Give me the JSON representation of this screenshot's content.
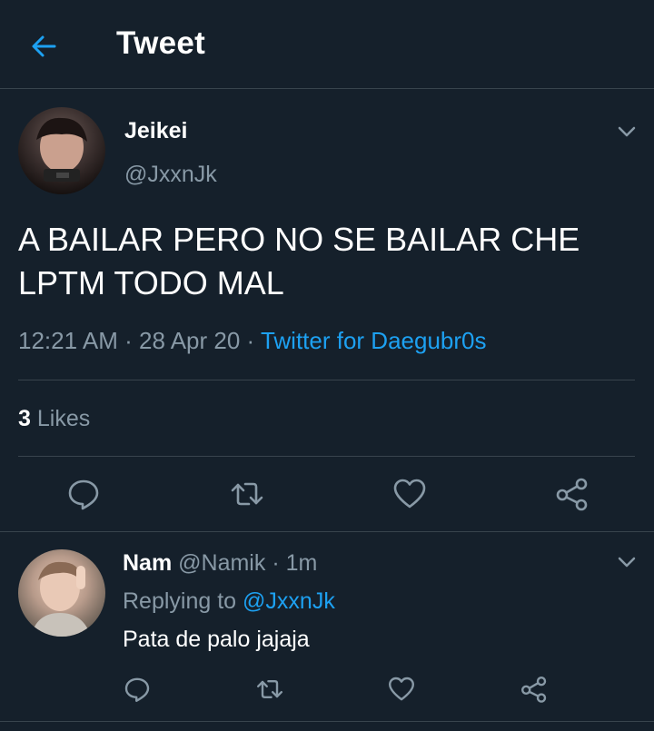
{
  "header": {
    "title": "Tweet",
    "back_icon": "arrow-left-icon"
  },
  "colors": {
    "background": "#15202b",
    "accent": "#1da1f2",
    "muted": "#8899a6",
    "border": "#38444d"
  },
  "tweet": {
    "author_name": "Jeikei",
    "author_handle": "@JxxnJk",
    "text_line1": "A BAILAR PERO NO SE BAILAR CHE",
    "text_line2": "LPTM TODO MAL",
    "time": "12:21 AM",
    "date": "28 Apr 20",
    "source": "Twitter for Daegubr0s",
    "likes_count": "3",
    "likes_label": "Likes",
    "actions": [
      "reply-icon",
      "retweet-icon",
      "like-icon",
      "share-icon"
    ]
  },
  "reply": {
    "name": "Nam",
    "handle": "@Namik",
    "time": "1m",
    "replying_label": "Replying to",
    "replying_to": "@JxxnJk",
    "text": "Pata de palo jajaja",
    "actions": [
      "reply-icon",
      "retweet-icon",
      "like-icon",
      "share-icon"
    ]
  }
}
